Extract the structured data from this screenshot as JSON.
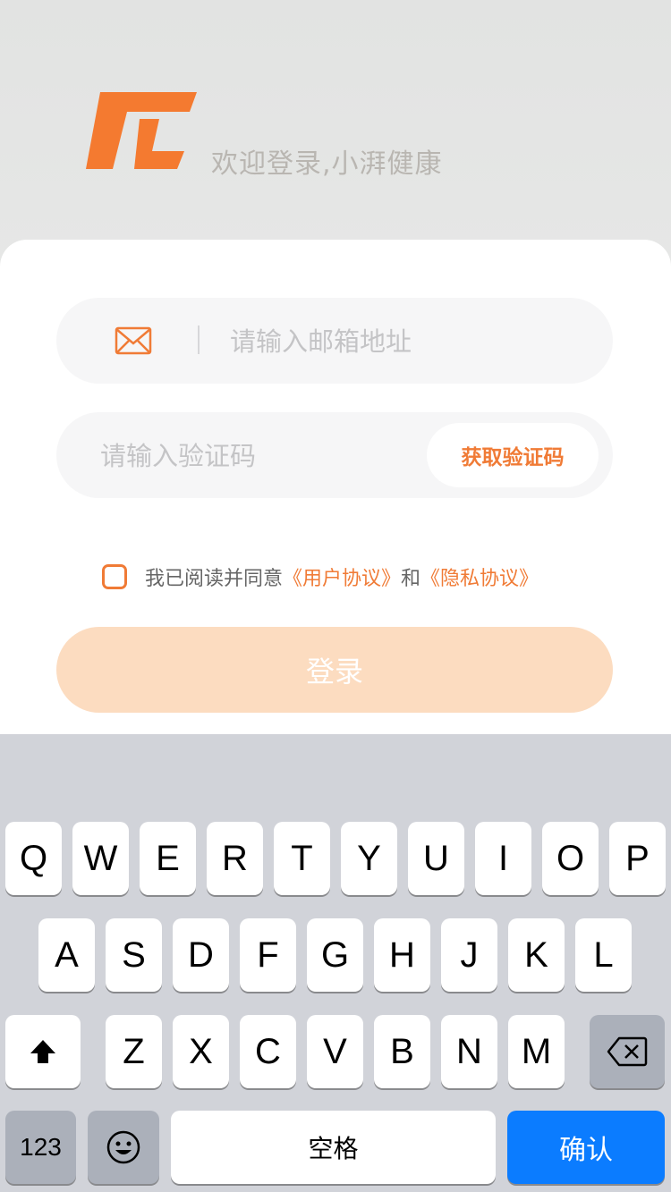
{
  "header": {
    "welcome_text": "欢迎登录,小湃健康"
  },
  "brand": {
    "accent_color": "#f07b36",
    "logo_icon": "brand-logo-icon"
  },
  "form": {
    "email_placeholder": "请输入邮箱地址",
    "code_placeholder": "请输入验证码",
    "get_code_label": "获取验证码",
    "agree_prefix": "我已阅读并同意",
    "user_agreement": "《用户协议》",
    "and_text": "和",
    "privacy_agreement": "《隐私协议》",
    "login_label": "登录"
  },
  "keyboard": {
    "row1": [
      "Q",
      "W",
      "E",
      "R",
      "T",
      "Y",
      "U",
      "I",
      "O",
      "P"
    ],
    "row2": [
      "A",
      "S",
      "D",
      "F",
      "G",
      "H",
      "J",
      "K",
      "L"
    ],
    "row3": [
      "Z",
      "X",
      "C",
      "V",
      "B",
      "N",
      "M"
    ],
    "numbers_label": "123",
    "space_label": "空格",
    "confirm_label": "确认"
  }
}
